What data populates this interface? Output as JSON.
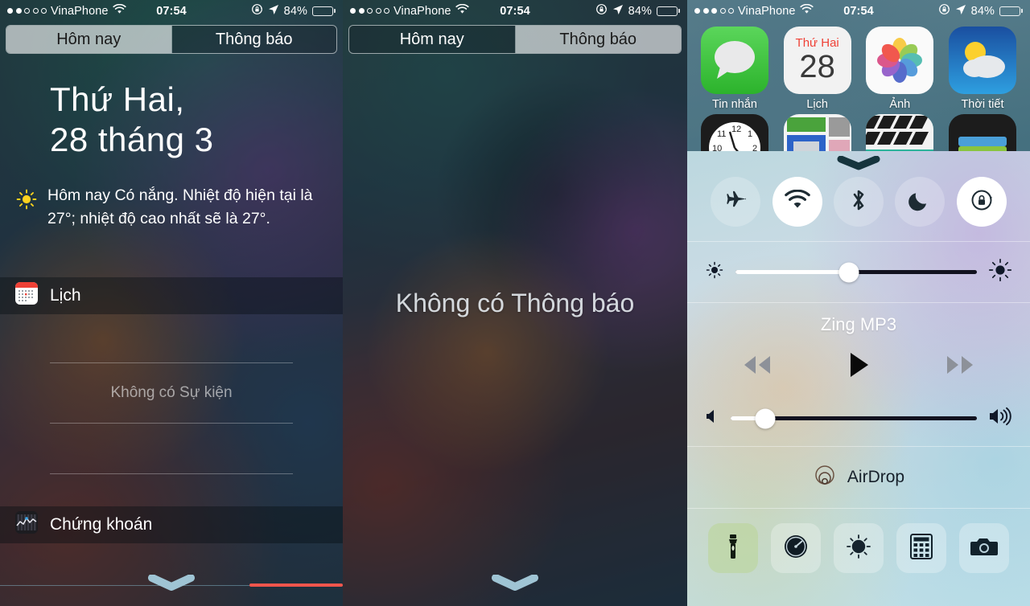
{
  "status_bar": {
    "carrier": "VinaPhone",
    "time": "07:54",
    "battery_percent": "84%",
    "signal_dots_filled_1": 2,
    "signal_dots_filled_3": 3,
    "signal_dots_total": 5,
    "wifi_icon": "wifi-icon",
    "rotation_lock_icon": "rotation-lock-icon",
    "location_icon": "location-arrow-icon",
    "battery_icon": "battery-icon"
  },
  "segmented": {
    "today_label": "Hôm nay",
    "notifications_label": "Thông báo",
    "panel1_active": "today",
    "panel2_active": "notifications"
  },
  "today_view": {
    "date_line1": "Thứ Hai,",
    "date_line2": "28 tháng 3",
    "weather_icon": "sun-icon",
    "weather_text": "Hôm nay Có nắng. Nhiệt độ hiện tại là 27°; nhiệt độ cao nhất sẽ là 27°.",
    "widgets": [
      {
        "icon": "calendar-app-icon",
        "title": "Lịch",
        "empty_text": "Không có Sự kiện"
      },
      {
        "icon": "stocks-app-icon",
        "title": "Chứng khoán"
      }
    ],
    "grabber_icon": "grabber-chevron-icon"
  },
  "notifications_view": {
    "empty_text": "Không có Thông báo",
    "grabber_icon": "grabber-chevron-icon"
  },
  "home_screen": {
    "rows": [
      [
        {
          "label": "Tin nhắn",
          "icon": "messages-app-icon"
        },
        {
          "label": "Lịch",
          "icon": "calendar-app-icon",
          "weekday": "Thứ Hai",
          "day": "28"
        },
        {
          "label": "Ảnh",
          "icon": "photos-app-icon"
        },
        {
          "label": "Thời tiết",
          "icon": "weather-app-icon"
        }
      ],
      [
        {
          "label": "",
          "icon": "clock-app-icon"
        },
        {
          "label": "",
          "icon": "news-app-icon"
        },
        {
          "label": "",
          "icon": "imovie-app-icon"
        },
        {
          "label": "",
          "icon": "wallet-app-icon"
        }
      ]
    ]
  },
  "control_center": {
    "grabber_icon": "grabber-chevron-icon",
    "toggles": [
      {
        "name": "airplane-mode",
        "icon": "airplane-icon",
        "active": false
      },
      {
        "name": "wifi",
        "icon": "wifi-icon",
        "active": true
      },
      {
        "name": "bluetooth",
        "icon": "bluetooth-icon",
        "active": false
      },
      {
        "name": "do-not-disturb",
        "icon": "moon-icon",
        "active": false
      },
      {
        "name": "rotation-lock",
        "icon": "rotation-lock-icon",
        "active": true
      }
    ],
    "brightness": {
      "value_percent": 47,
      "low_icon": "brightness-low-icon",
      "high_icon": "brightness-high-icon"
    },
    "media": {
      "title": "Zing MP3",
      "prev_icon": "rewind-icon",
      "play_icon": "play-icon",
      "next_icon": "fast-forward-icon"
    },
    "volume": {
      "value_percent": 14,
      "low_icon": "volume-low-icon",
      "high_icon": "volume-high-icon"
    },
    "airdrop": {
      "label": "AirDrop",
      "icon": "airdrop-icon"
    },
    "shortcuts": [
      {
        "name": "flashlight",
        "icon": "flashlight-icon",
        "active": true
      },
      {
        "name": "timer",
        "icon": "timer-icon",
        "active": false
      },
      {
        "name": "night-shift",
        "icon": "night-shift-icon",
        "active": false
      },
      {
        "name": "calculator",
        "icon": "calculator-icon",
        "active": false
      },
      {
        "name": "camera",
        "icon": "camera-icon",
        "active": false
      }
    ]
  },
  "colors": {
    "accent_blue": "#4aa8e0",
    "stock_red": "#f0554c",
    "cc_dark": "#16202a"
  }
}
